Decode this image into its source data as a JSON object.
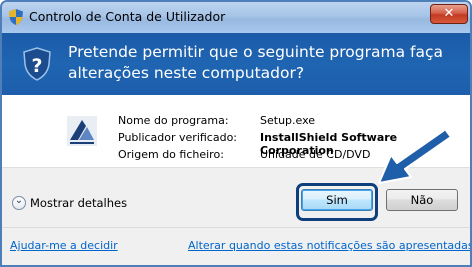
{
  "window": {
    "title": "Controlo de Conta de Utilizador",
    "close_glyph": "✕"
  },
  "header": {
    "message": "Pretende permitir que o seguinte programa faça alterações neste computador?",
    "icon": "question-shield-icon"
  },
  "details": {
    "program_icon": "installshield-icon",
    "rows": [
      {
        "label": "Nome do programa:",
        "value": "Setup.exe"
      },
      {
        "label": "Publicador verificado:",
        "value": "InstallShield Software Corporation"
      },
      {
        "label": "Origem do ficheiro:",
        "value": "Unidade de CD/DVD"
      }
    ]
  },
  "actions": {
    "show_details": "Mostrar detalhes",
    "yes": "Sim",
    "no": "Não"
  },
  "footer": {
    "help_link": "Ajudar-me a decidir",
    "settings_link": "Alterar quando estas notificações são apresentadas"
  },
  "colors": {
    "header_blue": "#1f65b2",
    "annotation_arrow": "#1f5ea8",
    "link": "#0066cc"
  }
}
